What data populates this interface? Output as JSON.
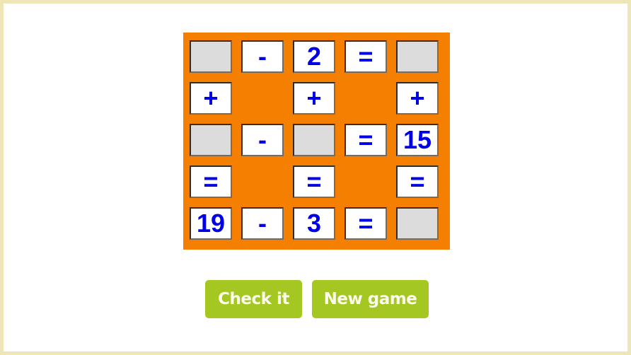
{
  "puzzle": {
    "rows": [
      [
        "",
        "-",
        "2",
        "=",
        ""
      ],
      [
        "+",
        null,
        "+",
        null,
        "+"
      ],
      [
        "",
        "-",
        "",
        "=",
        "15"
      ],
      [
        "=",
        null,
        "=",
        null,
        "="
      ],
      [
        "19",
        "-",
        "3",
        "=",
        ""
      ]
    ],
    "blank_cells": [
      [
        0,
        0
      ],
      [
        0,
        4
      ],
      [
        2,
        0
      ],
      [
        2,
        2
      ],
      [
        4,
        4
      ]
    ]
  },
  "buttons": {
    "check_label": "Check it",
    "new_game_label": "New game"
  },
  "colors": {
    "board": "#f57f00",
    "text": "#0000e6",
    "blank_cell": "#dcdcdc",
    "button": "#a5c722",
    "frame": "#efe6b8"
  }
}
